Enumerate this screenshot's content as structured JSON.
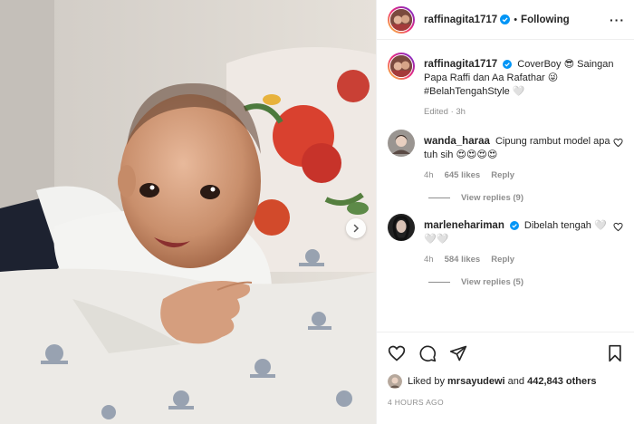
{
  "post": {
    "author": "raffinagita1717",
    "separator": "•",
    "follow_status": "Following",
    "more_label": "···"
  },
  "caption": {
    "username": "raffinagita1717",
    "text": "CoverBoy 😎 Saingan Papa Raffi dan Aa Rafathar 😜 #BelahTengahStyle 🤍",
    "edited_time": "Edited · 3h"
  },
  "comments": [
    {
      "username": "wanda_haraa",
      "text": "Cipung rambut model apa tuh sih 😍😍😍😍",
      "time": "4h",
      "likes": "645 likes",
      "reply_label": "Reply",
      "view_replies": "View replies (9)"
    },
    {
      "username": "marlenehariman",
      "text": "Dibelah tengah 🤍🤍🤍",
      "time": "4h",
      "likes": "584 likes",
      "reply_label": "Reply",
      "view_replies": "View replies (5)"
    }
  ],
  "likes": {
    "prefix": "Liked by ",
    "user": "mrsayudewi",
    "middle": " and ",
    "count": "442,843 others"
  },
  "timestamp": "4 HOURS AGO",
  "icons": {
    "verified": "verified-badge-icon",
    "next": "chevron-right-icon",
    "like": "heart-icon",
    "comment": "comment-icon",
    "share": "paper-plane-icon",
    "save": "bookmark-icon"
  },
  "colors": {
    "verified_blue": "#0095f6",
    "text": "#262626",
    "muted": "#8e8e8e"
  }
}
